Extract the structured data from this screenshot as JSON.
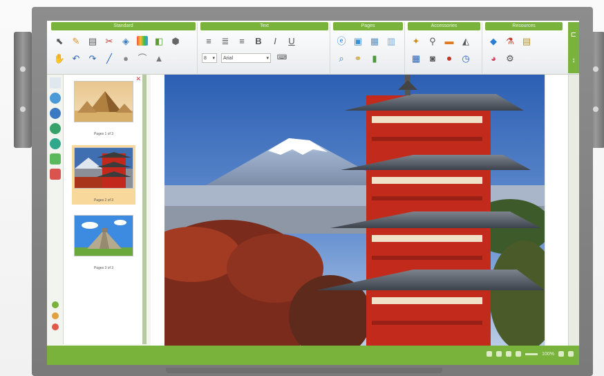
{
  "toolbar": {
    "groups": [
      "Standard",
      "Text",
      "Pages",
      "Accessories",
      "Resources"
    ],
    "font_size": "8",
    "font_name": "Arial"
  },
  "thumbnails": [
    {
      "caption": "Pages 1 of 3",
      "subject": "pyramids"
    },
    {
      "caption": "Pages 2 of 3",
      "subject": "pagoda"
    },
    {
      "caption": "Pages 3 of 3",
      "subject": "mayan-pyramid"
    }
  ],
  "selected_page": 2,
  "status": {
    "zoom": "100%"
  },
  "colors": {
    "brand_green": "#79b33c",
    "selection": "#f9d89b",
    "bezel": "#838383"
  },
  "icons": [
    "select-icon",
    "pen-icon",
    "eraser-icon",
    "color-palette-icon",
    "shape-icon",
    "undo-icon",
    "redo-icon",
    "line-icon",
    "align-left-icon",
    "align-center-icon",
    "align-right-icon",
    "bold-icon",
    "italic-icon",
    "underline-icon",
    "browser-icon",
    "image-icon",
    "search-icon",
    "chart-icon",
    "magic-wand-icon",
    "timer-icon",
    "camera-icon",
    "resource-icon",
    "settings-icon"
  ]
}
